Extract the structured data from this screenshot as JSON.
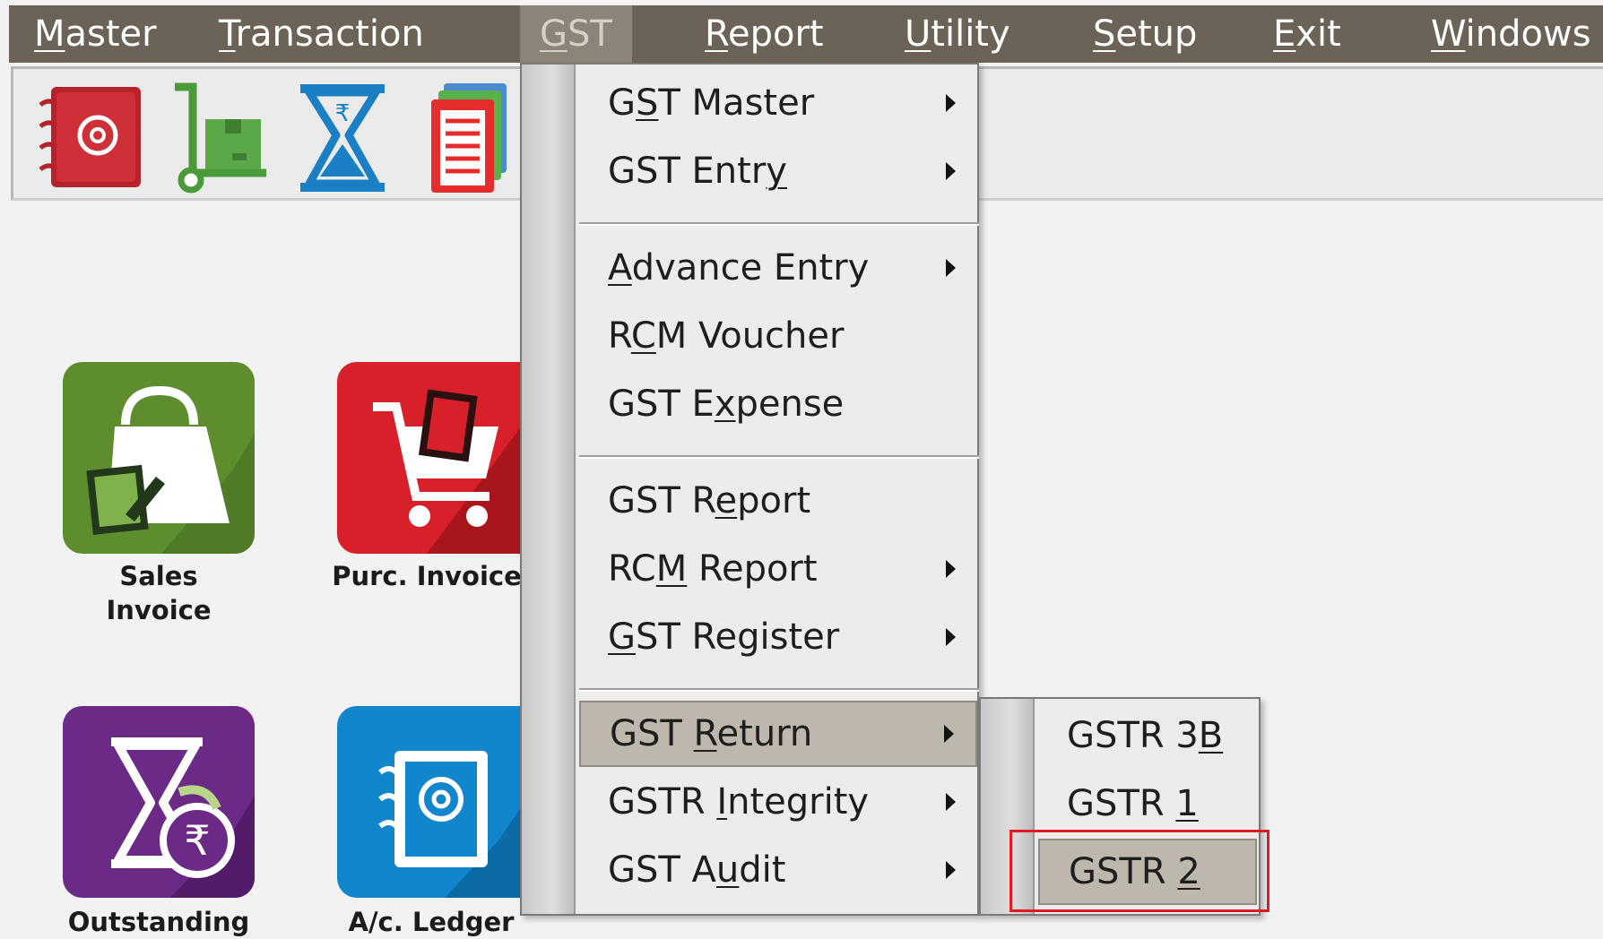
{
  "menubar": {
    "items": [
      {
        "label": "Master",
        "mnemonic": "M",
        "rest": "aster"
      },
      {
        "label": "Transaction",
        "mnemonic": "T",
        "rest": "ransaction"
      },
      {
        "label": "GST",
        "mnemonic": "G",
        "rest": "ST"
      },
      {
        "label": "Report",
        "mnemonic": "R",
        "rest": "eport"
      },
      {
        "label": "Utility",
        "mnemonic": "U",
        "rest": "tility"
      },
      {
        "label": "Setup",
        "mnemonic": "S",
        "rest": "etup"
      },
      {
        "label": "Exit",
        "mnemonic": "E",
        "rest": "xit"
      },
      {
        "label": "Windows",
        "mnemonic": "W",
        "rest": "indows"
      }
    ],
    "active": "GST"
  },
  "toolbar": {
    "icons": [
      "address-book-icon",
      "hand-truck-icon",
      "hourglass-rupee-icon",
      "documents-icon"
    ]
  },
  "tiles": [
    {
      "name": "sales-invoice",
      "label_line1": "Sales",
      "label_line2": "Invoice",
      "color": "#5e8d2e"
    },
    {
      "name": "purchase-invoice",
      "label_line1": "Purc. Invoice",
      "label_line2": "",
      "color": "#d8202a"
    },
    {
      "name": "outstanding",
      "label_line1": "Outstanding",
      "label_line2": "",
      "color": "#6a2a85"
    },
    {
      "name": "ac-ledger",
      "label_line1": "A/c. Ledger",
      "label_line2": "",
      "color": "#1286cc"
    }
  ],
  "gst_menu": {
    "items": [
      {
        "pre": "G",
        "mn": "S",
        "post": "T Master",
        "submenu": true
      },
      {
        "pre": "GST Entr",
        "mn": "y",
        "post": "",
        "submenu": true
      },
      {
        "pre": "",
        "mn": "A",
        "post": "dvance Entry",
        "submenu": true
      },
      {
        "pre": "R",
        "mn": "C",
        "post": "M Voucher",
        "submenu": false
      },
      {
        "pre": "GST E",
        "mn": "x",
        "post": "pense",
        "submenu": false
      },
      {
        "pre": "GST R",
        "mn": "e",
        "post": "port",
        "submenu": false
      },
      {
        "pre": "RC",
        "mn": "M",
        "post": " Report",
        "submenu": true
      },
      {
        "pre": "",
        "mn": "G",
        "post": "ST Register",
        "submenu": true
      },
      {
        "pre": "GST ",
        "mn": "R",
        "post": "eturn",
        "submenu": true
      },
      {
        "pre": "GSTR ",
        "mn": "I",
        "post": "ntegrity",
        "submenu": true
      },
      {
        "pre": "GST A",
        "mn": "u",
        "post": "dit",
        "submenu": true
      }
    ],
    "highlighted": "GST Return"
  },
  "gst_return_submenu": {
    "items": [
      {
        "pre": "GSTR 3",
        "mn": "B",
        "post": ""
      },
      {
        "pre": "GSTR ",
        "mn": "1",
        "post": ""
      },
      {
        "pre": "GSTR ",
        "mn": "2",
        "post": ""
      }
    ],
    "highlighted": "GSTR 2",
    "focus_color": "#e01b24"
  }
}
